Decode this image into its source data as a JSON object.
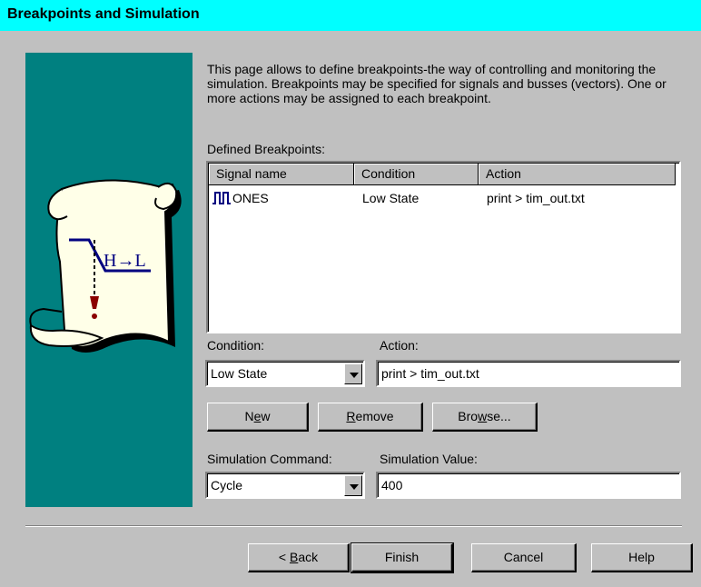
{
  "window": {
    "title": "Breakpoints and Simulation"
  },
  "description": "This page allows to define breakpoints-the way of controlling and monitoring the simulation. Breakpoints may be specified for signals and busses (vectors). One or more actions may be assigned to each breakpoint.",
  "illustration": {
    "scroll_text": "H→L",
    "icon": "transition-scroll-icon"
  },
  "breakpoints": {
    "label": "Defined Breakpoints:",
    "columns": [
      "Signal name",
      "Condition",
      "Action"
    ],
    "rows": [
      {
        "signal": "ONES",
        "condition": "Low State",
        "action": "print > tim_out.txt",
        "icon": "pulse-signal-icon"
      }
    ]
  },
  "condition": {
    "label": "Condition:",
    "value": "Low State"
  },
  "action": {
    "label": "Action:",
    "value": "print > tim_out.txt"
  },
  "buttons": {
    "new": {
      "pre": "N",
      "u": "e",
      "post": "w"
    },
    "remove": {
      "pre": "",
      "u": "R",
      "post": "emove"
    },
    "browse": {
      "pre": "Bro",
      "u": "w",
      "post": "se..."
    }
  },
  "simulation_command": {
    "label": "Simulation Command:",
    "value": "Cycle"
  },
  "simulation_value": {
    "label": "Simulation Value:",
    "value": "400"
  },
  "footer": {
    "back": {
      "pre": "< ",
      "u": "B",
      "post": "ack"
    },
    "finish": "Finish",
    "cancel": "Cancel",
    "help": "Help"
  },
  "colors": {
    "title_bar": "#00ffff",
    "side_panel": "#008080",
    "dialog": "#c0c0c0",
    "icon_blue": "#000080"
  }
}
